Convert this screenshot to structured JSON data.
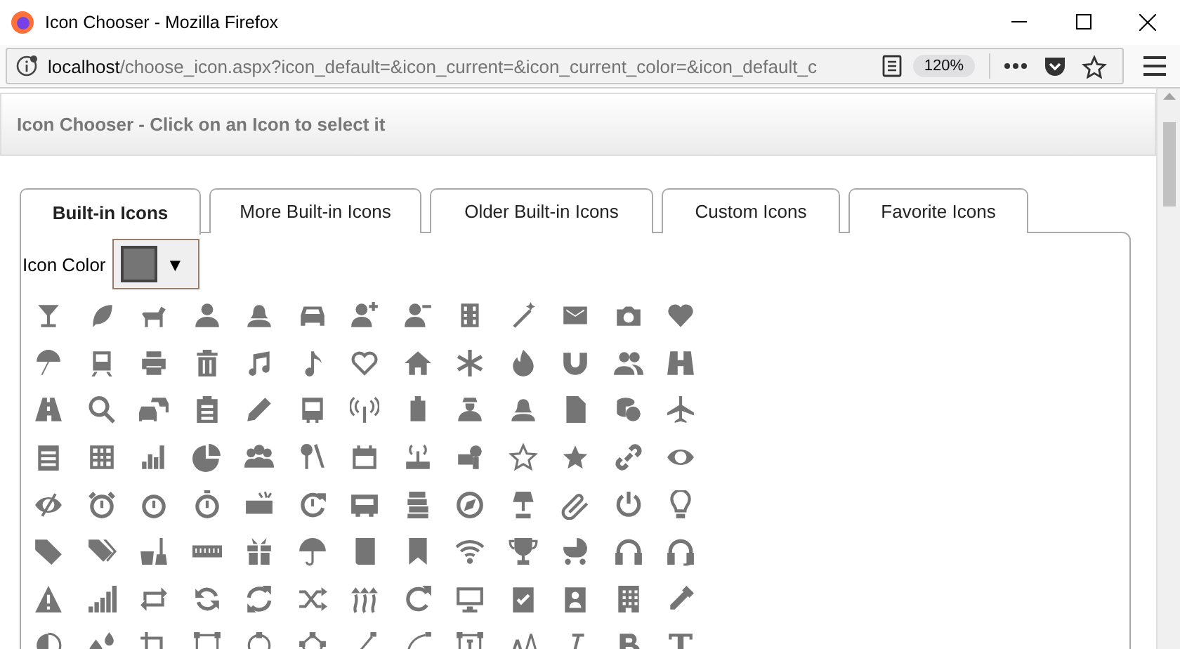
{
  "window": {
    "title": "Icon Chooser - Mozilla Firefox"
  },
  "address_bar": {
    "host": "localhost",
    "path": "/choose_icon.aspx?icon_default=&icon_current=&icon_current_color=&icon_default_c",
    "zoom": "120%"
  },
  "page": {
    "header": "Icon Chooser - Click on an Icon to select it"
  },
  "tabs": [
    {
      "label": "Built-in Icons",
      "selected": true
    },
    {
      "label": "More Built-in Icons",
      "selected": false
    },
    {
      "label": "Older Built-in Icons",
      "selected": false
    },
    {
      "label": "Custom Icons",
      "selected": false
    },
    {
      "label": "Favorite Icons",
      "selected": false
    }
  ],
  "icon_color": {
    "label": "Icon Color",
    "color": "#757575",
    "arrow": "▼"
  }
}
